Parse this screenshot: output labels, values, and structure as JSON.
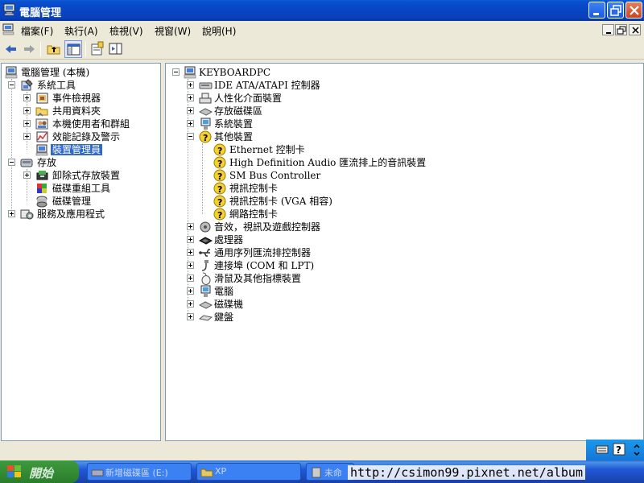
{
  "window": {
    "title": "電腦管理",
    "colors": {
      "titlebar": "#0a47c6",
      "chrome": "#ece9d8",
      "selection": "#316ac5",
      "close_button": "#d25a36"
    }
  },
  "menu": {
    "items": [
      "檔案(F)",
      "執行(A)",
      "檢視(V)",
      "視窗(W)",
      "說明(H)"
    ]
  },
  "toolbar": {
    "buttons": [
      "back-icon",
      "forward-icon",
      "up-folder-icon",
      "show-hide-tree-icon",
      "properties-icon",
      "help-panel-icon"
    ]
  },
  "left_tree": {
    "root": "電腦管理 (本機)",
    "system_tools": "系統工具",
    "event_viewer": "事件檢視器",
    "shared_folders": "共用資料夾",
    "local_users": "本機使用者和群組",
    "perf_logs": "效能記錄及警示",
    "device_manager": "裝置管理員",
    "storage": "存放",
    "removable_storage": "卸除式存放裝置",
    "defrag": "磁碟重組工具",
    "disk_mgmt": "磁碟管理",
    "services_apps": "服務及應用程式"
  },
  "right_tree": {
    "computer": "KEYBOARDPC",
    "categories": [
      "IDE ATA/ATAPI 控制器",
      "人性化介面裝置",
      "存放磁碟區",
      "系統裝置",
      "其他裝置",
      "音效，視訊及遊戲控制器",
      "處理器",
      "通用序列匯流排控制器",
      "連接埠 (COM 和 LPT)",
      "滑鼠及其他指標裝置",
      "電腦",
      "磁碟機",
      "鍵盤"
    ],
    "other_devices": [
      "Ethernet 控制卡",
      "High Definition Audio 匯流排上的音訊裝置",
      "SM Bus Controller",
      "視訊控制卡",
      "視訊控制卡 (VGA 相容)",
      "網路控制卡"
    ]
  },
  "taskbar": {
    "start": "開始",
    "tasks": [
      "新增磁碟區 (E:)",
      "XP",
      "未命"
    ]
  },
  "watermark": "http://csimon99.pixnet.net/album"
}
